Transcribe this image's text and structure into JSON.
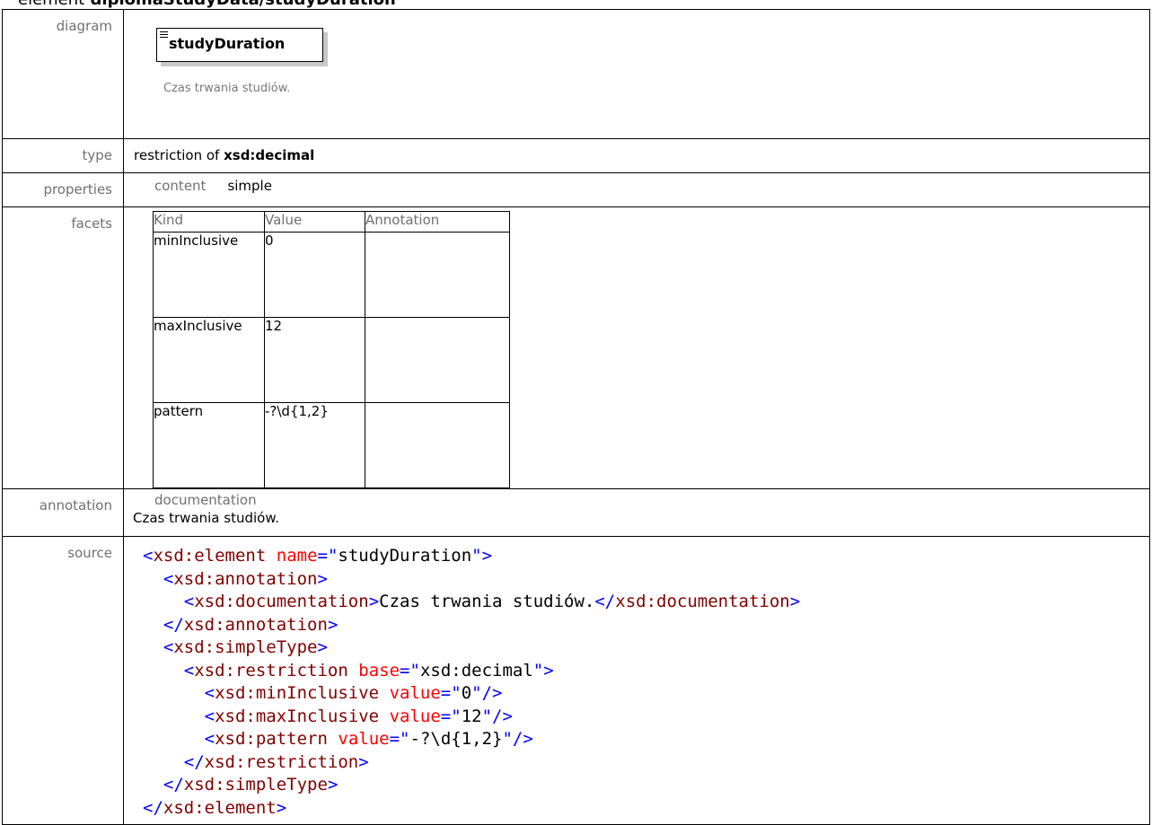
{
  "heading": {
    "label": "element",
    "path": "diplomaStudyData/studyDuration"
  },
  "rows": {
    "diagram": {
      "label": "diagram",
      "element_name": "studyDuration",
      "doc": "Czas trwania studiów."
    },
    "type": {
      "label": "type",
      "prefix": "restriction of",
      "base": "xsd:decimal"
    },
    "properties": {
      "label": "properties",
      "key": "content",
      "value": "simple"
    },
    "facets": {
      "label": "facets",
      "headers": [
        "Kind",
        "Value",
        "Annotation"
      ],
      "items": [
        {
          "kind": "minInclusive",
          "value": "0",
          "annotation": ""
        },
        {
          "kind": "maxInclusive",
          "value": "12",
          "annotation": ""
        },
        {
          "kind": "pattern",
          "value": "-?\\d{1,2}",
          "annotation": ""
        }
      ]
    },
    "annotation": {
      "label": "annotation",
      "heading": "documentation",
      "text": "Czas trwania studiów."
    },
    "source": {
      "label": "source",
      "lines": [
        {
          "indent": "",
          "parts": [
            [
              "br",
              "<"
            ],
            [
              "tag",
              "xsd:element"
            ],
            [
              "sp",
              " "
            ],
            [
              "attr",
              "name"
            ],
            [
              "br",
              "="
            ],
            [
              "br",
              "\""
            ],
            [
              "val",
              "studyDuration"
            ],
            [
              "br",
              "\""
            ],
            [
              "br",
              ">"
            ]
          ]
        },
        {
          "indent": "  ",
          "parts": [
            [
              "br",
              "<"
            ],
            [
              "tag",
              "xsd:annotation"
            ],
            [
              "br",
              ">"
            ]
          ]
        },
        {
          "indent": "    ",
          "parts": [
            [
              "br",
              "<"
            ],
            [
              "tag",
              "xsd:documentation"
            ],
            [
              "br",
              ">"
            ],
            [
              "val",
              "Czas trwania studiów."
            ],
            [
              "br",
              "</"
            ],
            [
              "tag",
              "xsd:documentation"
            ],
            [
              "br",
              ">"
            ]
          ]
        },
        {
          "indent": "  ",
          "parts": [
            [
              "br",
              "</"
            ],
            [
              "tag",
              "xsd:annotation"
            ],
            [
              "br",
              ">"
            ]
          ]
        },
        {
          "indent": "  ",
          "parts": [
            [
              "br",
              "<"
            ],
            [
              "tag",
              "xsd:simpleType"
            ],
            [
              "br",
              ">"
            ]
          ]
        },
        {
          "indent": "    ",
          "parts": [
            [
              "br",
              "<"
            ],
            [
              "tag",
              "xsd:restriction"
            ],
            [
              "sp",
              " "
            ],
            [
              "attr",
              "base"
            ],
            [
              "br",
              "="
            ],
            [
              "br",
              "\""
            ],
            [
              "val",
              "xsd:decimal"
            ],
            [
              "br",
              "\""
            ],
            [
              "br",
              ">"
            ]
          ]
        },
        {
          "indent": "      ",
          "parts": [
            [
              "br",
              "<"
            ],
            [
              "tag",
              "xsd:minInclusive"
            ],
            [
              "sp",
              " "
            ],
            [
              "attr",
              "value"
            ],
            [
              "br",
              "="
            ],
            [
              "br",
              "\""
            ],
            [
              "val",
              "0"
            ],
            [
              "br",
              "\""
            ],
            [
              "br",
              "/>"
            ]
          ]
        },
        {
          "indent": "      ",
          "parts": [
            [
              "br",
              "<"
            ],
            [
              "tag",
              "xsd:maxInclusive"
            ],
            [
              "sp",
              " "
            ],
            [
              "attr",
              "value"
            ],
            [
              "br",
              "="
            ],
            [
              "br",
              "\""
            ],
            [
              "val",
              "12"
            ],
            [
              "br",
              "\""
            ],
            [
              "br",
              "/>"
            ]
          ]
        },
        {
          "indent": "      ",
          "parts": [
            [
              "br",
              "<"
            ],
            [
              "tag",
              "xsd:pattern"
            ],
            [
              "sp",
              " "
            ],
            [
              "attr",
              "value"
            ],
            [
              "br",
              "="
            ],
            [
              "br",
              "\""
            ],
            [
              "val",
              "-?\\d{1,2}"
            ],
            [
              "br",
              "\""
            ],
            [
              "br",
              "/>"
            ]
          ]
        },
        {
          "indent": "    ",
          "parts": [
            [
              "br",
              "</"
            ],
            [
              "tag",
              "xsd:restriction"
            ],
            [
              "br",
              ">"
            ]
          ]
        },
        {
          "indent": "  ",
          "parts": [
            [
              "br",
              "</"
            ],
            [
              "tag",
              "xsd:simpleType"
            ],
            [
              "br",
              ">"
            ]
          ]
        },
        {
          "indent": "",
          "parts": [
            [
              "br",
              "</"
            ],
            [
              "tag",
              "xsd:element"
            ],
            [
              "br",
              ">"
            ]
          ]
        }
      ]
    }
  },
  "colors": {
    "tag": "#800000",
    "bracket": "#0000ff",
    "attr": "#ff0000",
    "label": "#707070"
  }
}
